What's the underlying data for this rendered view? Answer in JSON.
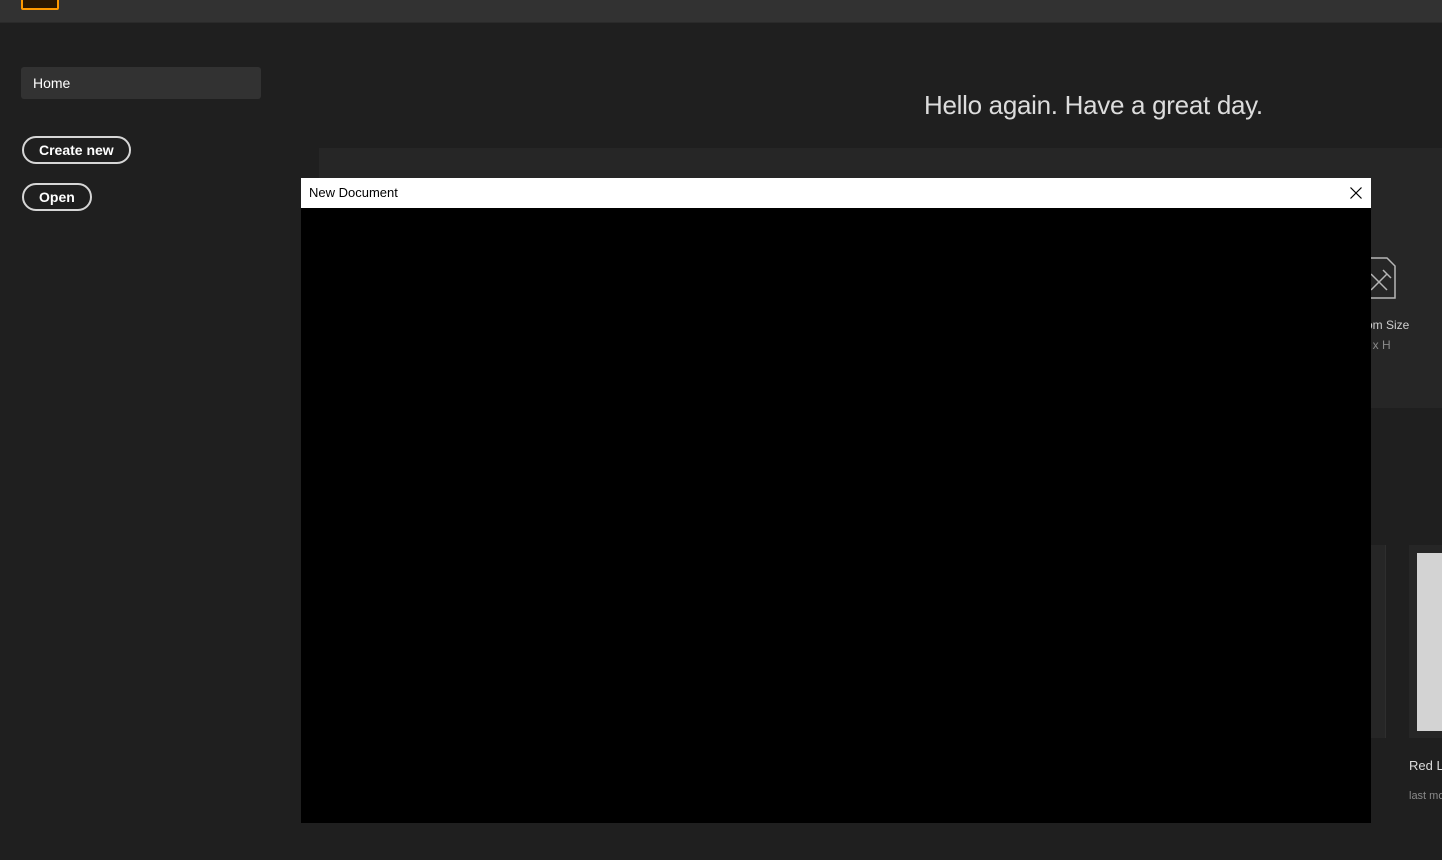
{
  "sidebar": {
    "home_label": "Home",
    "create_new_label": "Create new",
    "open_label": "Open"
  },
  "main": {
    "greeting": "Hello again. Have a great day.",
    "presets": {
      "custom_size_label": "om Size",
      "custom_size_dims": "/ x H"
    },
    "recent": {
      "name": "Red L",
      "meta": "last mo"
    }
  },
  "dialog": {
    "title": "New Document"
  },
  "icons": {
    "app_logo": "app-logo-icon",
    "custom_size": "custom-size-icon",
    "close": "close-icon"
  },
  "colors": {
    "background": "#1f1f1f",
    "topbar": "#323232",
    "accent": "#ff9a00",
    "dialog_titlebar": "#ffffff",
    "dialog_body": "#000000"
  }
}
